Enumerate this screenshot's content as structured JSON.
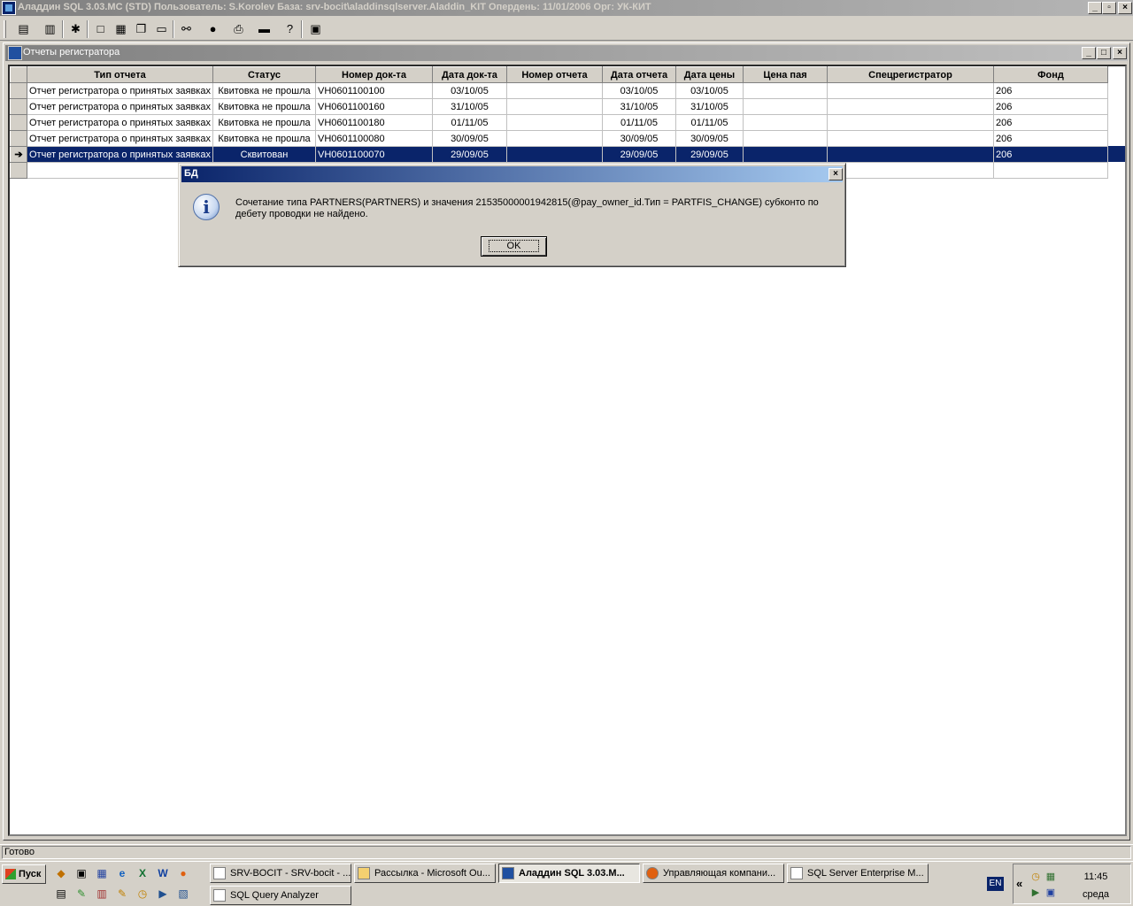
{
  "app": {
    "title": "Аладдин SQL 3.03.MC (STD)  Пользователь: S.Korolev База: srv-bocit\\aladdinsqlserver.Aladdin_KIT Опердень: 11/01/2006 Орг: УК-КИТ",
    "window_buttons": [
      "_",
      "▫",
      "×"
    ]
  },
  "toolbar": {
    "icons": [
      "notepad-icon",
      "database-icon",
      "settings-icon",
      "window-icon",
      "tile-icon",
      "cascade-icon",
      "blank-window-icon",
      "find-icon",
      "stop-icon",
      "print-icon",
      "export-icon",
      "help-icon",
      "exit-icon"
    ]
  },
  "child_window": {
    "title": "Отчеты регистратора",
    "window_buttons": [
      "_",
      "□",
      "×"
    ]
  },
  "grid": {
    "columns": [
      "Тип отчета",
      "Статус",
      "Номер док-та",
      "Дата док-та",
      "Номер отчета",
      "Дата отчета",
      "Дата цены",
      "Цена пая",
      "Спецрегистратор",
      "Фонд"
    ],
    "rows": [
      [
        "Отчет регистратора о принятых заявках",
        "Квитовка не прошла",
        "VH0601100100",
        "03/10/05",
        "",
        "03/10/05",
        "03/10/05",
        "",
        "",
        "206"
      ],
      [
        "Отчет регистратора о принятых заявках",
        "Квитовка не прошла",
        "VH0601100160",
        "31/10/05",
        "",
        "31/10/05",
        "31/10/05",
        "",
        "",
        "206"
      ],
      [
        "Отчет регистратора о принятых заявках",
        "Квитовка не прошла",
        "VH0601100180",
        "01/11/05",
        "",
        "01/11/05",
        "01/11/05",
        "",
        "",
        "206"
      ],
      [
        "Отчет регистратора о принятых заявках",
        "Квитовка не прошла",
        "VH0601100080",
        "30/09/05",
        "",
        "30/09/05",
        "30/09/05",
        "",
        "",
        "206"
      ],
      [
        "Отчет регистратора о принятых заявках",
        "Сквитован",
        "VH0601100070",
        "29/09/05",
        "",
        "29/09/05",
        "29/09/05",
        "",
        "",
        "206"
      ]
    ],
    "selected_row": 4,
    "row_indicator": "➔"
  },
  "dialog": {
    "title": "БД",
    "close_glyph": "×",
    "icon_glyph": "i",
    "message": "Сочетание типа PARTNERS(PARTNERS) и значения 21535000001942815(@pay_owner_id.Тип = PARTFIS_CHANGE) субконто по дебету проводки не найдено.",
    "ok_label": "OK"
  },
  "statusbar": {
    "text": "Готово"
  },
  "taskbar": {
    "start_label": "Пуск",
    "quicklaunch": [
      "◆",
      "▣",
      "▦",
      "e",
      "X",
      "W",
      "●",
      "▤",
      "✎",
      "▥",
      "✎",
      "◷",
      "▶",
      "▧"
    ],
    "tasks": [
      {
        "label": "SRV-BOCIT - SRV-bocit - ...",
        "active": false
      },
      {
        "label": "Рассылка - Microsoft Ou...",
        "active": false
      },
      {
        "label": "Аладдин SQL 3.03.M...",
        "active": true
      },
      {
        "label": "Управляющая компани...",
        "active": false
      },
      {
        "label": "SQL Server Enterprise M...",
        "active": false
      },
      {
        "label": "SQL Query Analyzer",
        "active": false
      }
    ],
    "language": "EN",
    "tray_chevron": "«",
    "clock": "11:45",
    "day": "среда"
  }
}
